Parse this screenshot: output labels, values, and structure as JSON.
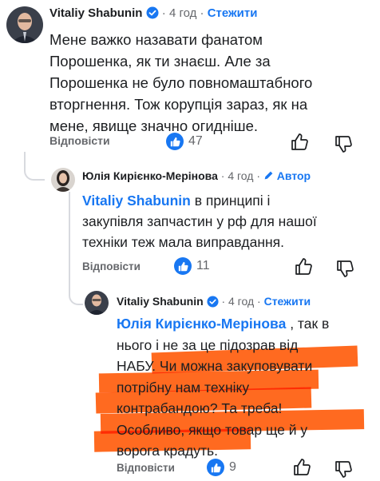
{
  "comment1": {
    "author": "Vitaliy Shabunin",
    "time": "4 год",
    "follow_label": "Стежити",
    "lines": [
      "Мене важко назавати фанатом",
      "Порошенка, як ти знаєш. Але за",
      "Порошенка не було повномаштабного",
      "вторгнення. Тож корупція зараз, як на",
      "мене, явище значно огидніше."
    ],
    "reply_label": "Відповісти",
    "likes": "47"
  },
  "comment2": {
    "author": "Юлія Кирієнко-Мерінова",
    "time": "4 год",
    "author_badge": "Автор",
    "mention": "Vitaliy Shabunin",
    "line1_rest": " в принципі і",
    "lines": [
      "закупівля запчастин у рф для нашої",
      "техніки теж мала виправдання."
    ],
    "reply_label": "Відповісти",
    "likes": "11"
  },
  "comment3": {
    "author": "Vitaliy Shabunin",
    "time": "4 год",
    "follow_label": "Стежити",
    "mention": "Юлія Кирієнко-Мерінова",
    "line1_rest": " , так в",
    "lines": [
      "нього і не за це підозрав від",
      "НАБУ. Чи можна закуповувати",
      "потрібну нам техніку",
      "контрабандою? Та треба!",
      "Особливо, якщо товар ще й у",
      "ворога крадуть."
    ],
    "reply_label": "Відповісти",
    "likes": "9"
  },
  "colors": {
    "link_blue": "#1877f2",
    "meta_gray": "#65676b",
    "highlight_orange": "#ff6a20"
  }
}
